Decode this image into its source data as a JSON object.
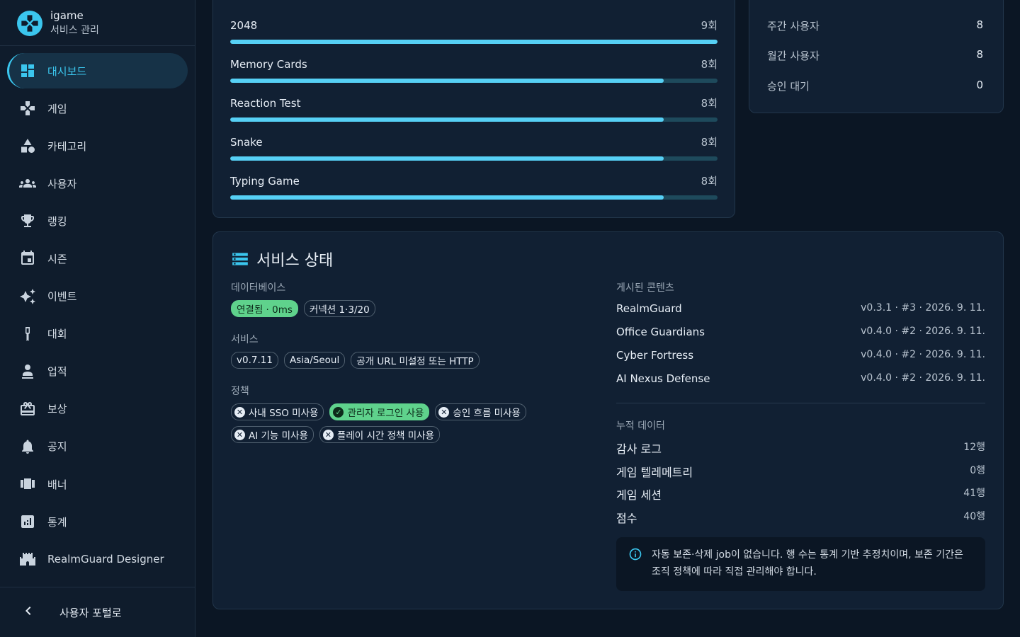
{
  "brand": {
    "name": "igame",
    "subtitle": "서비스 관리"
  },
  "sidebar": {
    "items": [
      {
        "label": "대시보드",
        "icon": "dashboard-icon",
        "active": true
      },
      {
        "label": "게임",
        "icon": "gamepad-icon"
      },
      {
        "label": "카테고리",
        "icon": "category-icon"
      },
      {
        "label": "사용자",
        "icon": "people-icon"
      },
      {
        "label": "랭킹",
        "icon": "trophy-icon"
      },
      {
        "label": "시즌",
        "icon": "calendar-icon"
      },
      {
        "label": "이벤트",
        "icon": "sparkle-icon"
      },
      {
        "label": "대회",
        "icon": "medal-icon"
      },
      {
        "label": "업적",
        "icon": "person-badge-icon"
      },
      {
        "label": "보상",
        "icon": "gift-icon"
      },
      {
        "label": "공지",
        "icon": "bell-icon"
      },
      {
        "label": "배너",
        "icon": "banner-icon"
      },
      {
        "label": "통계",
        "icon": "stats-icon"
      },
      {
        "label": "RealmGuard Designer",
        "icon": "castle-icon"
      }
    ],
    "portal_label": "사용자 포털로"
  },
  "play_counts": [
    {
      "name": "2048",
      "count": "9회",
      "fraction": 1.0
    },
    {
      "name": "Memory Cards",
      "count": "8회",
      "fraction": 0.889
    },
    {
      "name": "Reaction Test",
      "count": "8회",
      "fraction": 0.889
    },
    {
      "name": "Snake",
      "count": "8회",
      "fraction": 0.889
    },
    {
      "name": "Typing Game",
      "count": "8회",
      "fraction": 0.889
    }
  ],
  "user_stats": [
    {
      "label": "주간 사용자",
      "value": "8"
    },
    {
      "label": "월간 사용자",
      "value": "8"
    },
    {
      "label": "승인 대기",
      "value": "0"
    }
  ],
  "status": {
    "title": "서비스 상태",
    "database": {
      "label": "데이터베이스",
      "connected": "연결됨 · 0ms",
      "connections": "커넥션 1·3/20"
    },
    "service": {
      "label": "서비스",
      "version": "v0.7.11",
      "timezone": "Asia/Seoul",
      "url_status": "공개 URL 미설정 또는 HTTP"
    },
    "policy": {
      "label": "정책",
      "items": [
        {
          "text": "사내 SSO 미사용",
          "ok": false
        },
        {
          "text": "관리자 로그인 사용",
          "ok": true
        },
        {
          "text": "승인 흐름 미사용",
          "ok": false
        },
        {
          "text": "AI 기능 미사용",
          "ok": false
        },
        {
          "text": "플레이 시간 정책 미사용",
          "ok": false
        }
      ]
    },
    "published": {
      "label": "게시된 콘텐츠",
      "items": [
        {
          "name": "RealmGuard",
          "meta": "v0.3.1 · #3 · 2026. 9. 11."
        },
        {
          "name": "Office Guardians",
          "meta": "v0.4.0 · #2 · 2026. 9. 11."
        },
        {
          "name": "Cyber Fortress",
          "meta": "v0.4.0 · #2 · 2026. 9. 11."
        },
        {
          "name": "AI Nexus Defense",
          "meta": "v0.4.0 · #2 · 2026. 9. 11."
        }
      ]
    },
    "accumulated": {
      "label": "누적 데이터",
      "items": [
        {
          "name": "감사 로그",
          "rows": "12행"
        },
        {
          "name": "게임 텔레메트리",
          "rows": "0행"
        },
        {
          "name": "게임 세션",
          "rows": "41행"
        },
        {
          "name": "점수",
          "rows": "40행"
        }
      ]
    },
    "note": "자동 보존·삭제 job이 없습니다. 행 수는 통계 기반 추정치이며, 보존 기간은 조직 정책에 따라 직접 관리해야 합니다."
  },
  "colors": {
    "accent": "#3bc6ee",
    "success": "#5fd28c",
    "background": "#0b1624",
    "card": "#112033"
  }
}
